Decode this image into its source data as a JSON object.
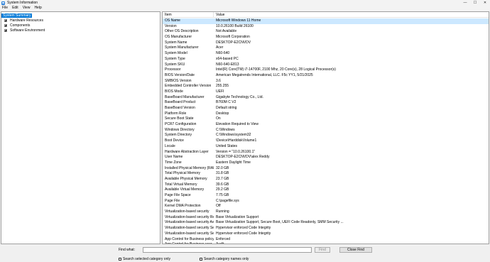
{
  "window": {
    "title": "System Information",
    "controls": {
      "minimize": "—",
      "maximize": "☐",
      "close": "✕"
    }
  },
  "menu": [
    "File",
    "Edit",
    "View",
    "Help"
  ],
  "tree": {
    "items": [
      {
        "label": "System Summary",
        "selected": true,
        "expandable": false
      },
      {
        "label": "Hardware Resources",
        "selected": false,
        "expandable": true
      },
      {
        "label": "Components",
        "selected": false,
        "expandable": true
      },
      {
        "label": "Software Environment",
        "selected": false,
        "expandable": true
      }
    ]
  },
  "list": {
    "headers": {
      "item": "Item",
      "value": "Value"
    },
    "rows": [
      {
        "item": "OS Name",
        "value": "Microsoft Windows 11 Home",
        "selected": true
      },
      {
        "item": "Version",
        "value": "10.0.26100 Build 26100"
      },
      {
        "item": "Other OS Description",
        "value": "Not Available"
      },
      {
        "item": "OS Manufacturer",
        "value": "Microsoft Corporation"
      },
      {
        "item": "System Name",
        "value": "DESKTOP-E2CNVDV"
      },
      {
        "item": "System Manufacturer",
        "value": "Acer"
      },
      {
        "item": "System Model",
        "value": "N60-640"
      },
      {
        "item": "System Type",
        "value": "x64-based PC"
      },
      {
        "item": "System SKU",
        "value": "N60-640-E813"
      },
      {
        "item": "Processor",
        "value": "Intel(R) Core(TM) i7-14700F, 2100 Mhz, 20 Core(s), 28 Logical Processor(s)"
      },
      {
        "item": "BIOS Version/Date",
        "value": "American Megatrends International, LLC. F5c YY1, 5/21/2025"
      },
      {
        "item": "SMBIOS Version",
        "value": "3.6"
      },
      {
        "item": "Embedded Controller Version",
        "value": "255.255"
      },
      {
        "item": "BIOS Mode",
        "value": "UEFI"
      },
      {
        "item": "BaseBoard Manufacturer",
        "value": "Gigabyte Technology Co., Ltd."
      },
      {
        "item": "BaseBoard Product",
        "value": "B760M C V2"
      },
      {
        "item": "BaseBoard Version",
        "value": "Default string"
      },
      {
        "item": "Platform Role",
        "value": "Desktop"
      },
      {
        "item": "Secure Boot State",
        "value": "On"
      },
      {
        "item": "PCR7 Configuration",
        "value": "Elevation Required to View"
      },
      {
        "item": "Windows Directory",
        "value": "C:\\Windows"
      },
      {
        "item": "System Directory",
        "value": "C:\\Windows\\system32"
      },
      {
        "item": "Boot Device",
        "value": "\\Device\\HarddiskVolume1"
      },
      {
        "item": "Locale",
        "value": "United States"
      },
      {
        "item": "Hardware Abstraction Layer",
        "value": "Version = \"10.0.26100.1\""
      },
      {
        "item": "User Name",
        "value": "DESKTOP-E2CNVDV\\alex Reddy"
      },
      {
        "item": "Time Zone",
        "value": "Eastern Daylight Time"
      },
      {
        "item": "Installed Physical Memory (RAM)",
        "value": "32.0 GB"
      },
      {
        "item": "Total Physical Memory",
        "value": "31.8 GB"
      },
      {
        "item": "Available Physical Memory",
        "value": "23.7 GB"
      },
      {
        "item": "Total Virtual Memory",
        "value": "39.6 GB"
      },
      {
        "item": "Available Virtual Memory",
        "value": "29.2 GB"
      },
      {
        "item": "Page File Space",
        "value": "7.75 GB"
      },
      {
        "item": "Page File",
        "value": "C:\\pagefile.sys"
      },
      {
        "item": "Kernel DMA Protection",
        "value": "Off"
      },
      {
        "item": "Virtualization-based security",
        "value": "Running"
      },
      {
        "item": "Virtualization-based security Re...",
        "value": "Base Virtualization Support"
      },
      {
        "item": "Virtualization-based security Av...",
        "value": "Base Virtualization Support, Secure Boot, UEFI Code Readonly, SMM Security ..."
      },
      {
        "item": "Virtualization-based security Se...",
        "value": "Hypervisor enforced Code Integrity"
      },
      {
        "item": "Virtualization-based security Se...",
        "value": "Hypervisor enforced Code Integrity"
      },
      {
        "item": "App Control for Business policy",
        "value": "Enforced"
      },
      {
        "item": "App Control for Business user ...",
        "value": "Audit"
      }
    ]
  },
  "find": {
    "label": "Find what:",
    "value": "",
    "find_button": "Find",
    "close_button": "Close Find",
    "check_selected": "Search selected category only",
    "check_names": "Search category names only"
  }
}
